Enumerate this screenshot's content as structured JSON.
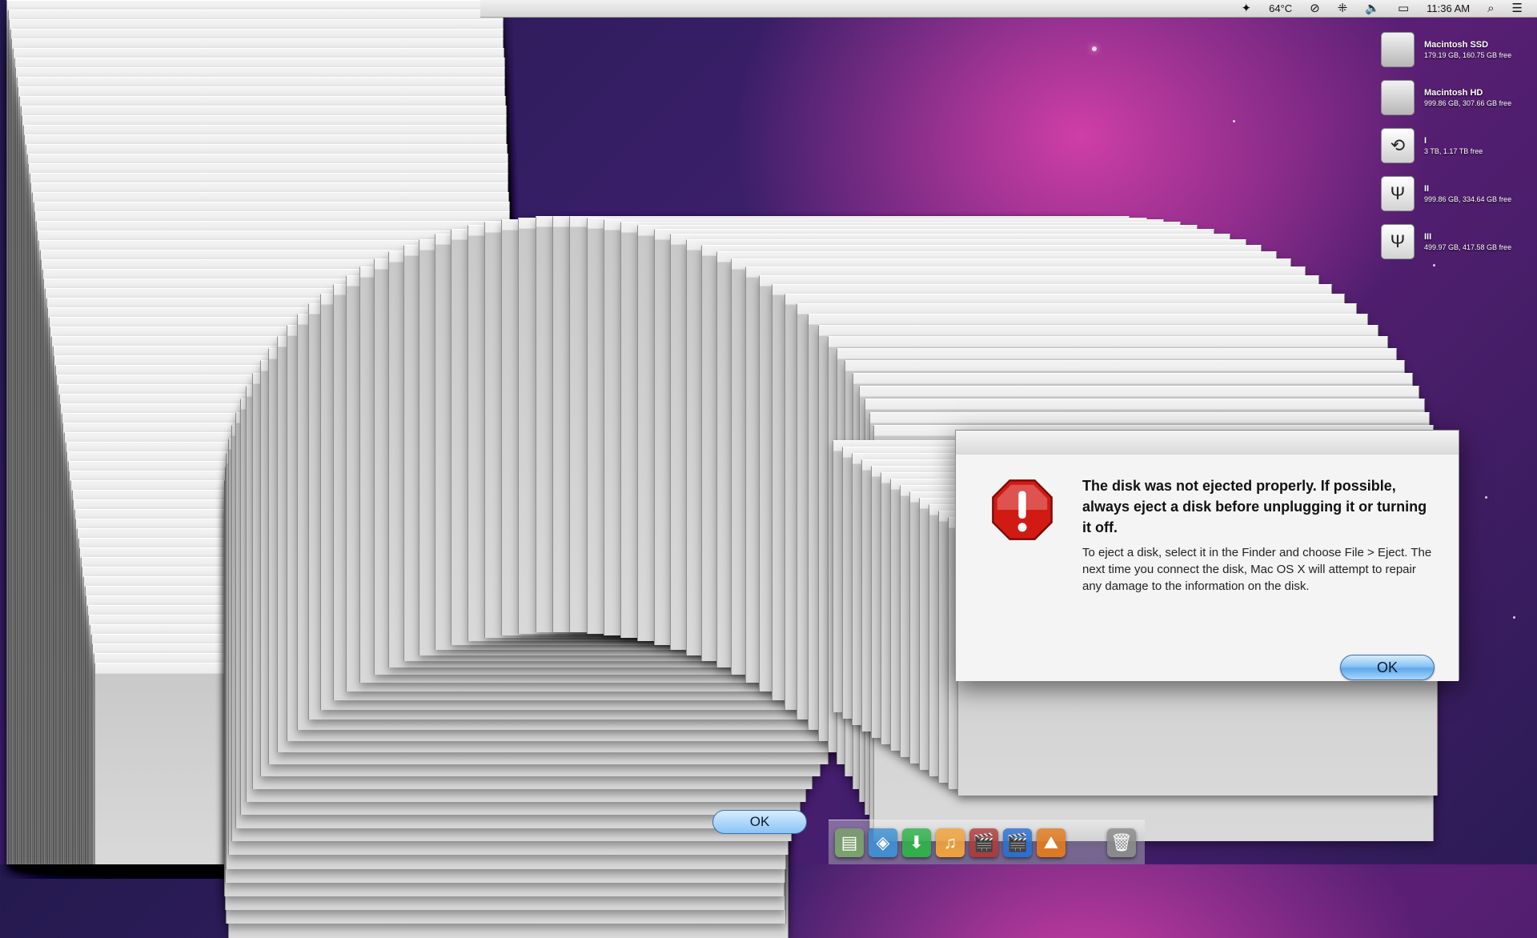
{
  "menubar": {
    "temperature": "64°C",
    "clock": "11:36 AM",
    "icons": [
      "dropbox-icon",
      "thermometer-reading",
      "sync-icon",
      "bluetooth-icon",
      "volume-icon",
      "battery-icon",
      "spotlight-icon",
      "notification-list-icon"
    ]
  },
  "desktop_disks": [
    {
      "name": "Macintosh SSD",
      "info": "179.19 GB, 160.75 GB free",
      "icon": "hard-drive-icon"
    },
    {
      "name": "Macintosh HD",
      "info": "999.86 GB, 307.66 GB free",
      "icon": "hard-drive-icon"
    },
    {
      "name": "I",
      "info": "3 TB, 1.17 TB free",
      "icon": "time-machine-icon"
    },
    {
      "name": "II",
      "info": "999.86 GB, 334.64 GB free",
      "icon": "usb-drive-icon"
    },
    {
      "name": "III",
      "info": "499.97 GB, 417.58 GB free",
      "icon": "usb-drive-icon"
    }
  ],
  "dialog": {
    "title": "The disk was not ejected properly. If possible, always eject a disk before unplugging it or turning it off.",
    "message": "To eject a disk, select it in the Finder and choose File > Eject. The next time you connect the disk, Mac OS X will attempt to repair any damage to the information on the disk.",
    "ok_label": "OK",
    "icon": "alert-stop-icon"
  },
  "dock": {
    "apps": [
      {
        "name": "finder-document",
        "color": "#7aa36a",
        "glyph": "▤"
      },
      {
        "name": "3d-box-app",
        "color": "#3f8fd2",
        "glyph": "◈"
      },
      {
        "name": "downloader-app",
        "color": "#2fb14a",
        "glyph": "⬇"
      },
      {
        "name": "itunes-app",
        "color": "#f0a23a",
        "glyph": "♫"
      },
      {
        "name": "video-editor-app",
        "color": "#b03a3a",
        "glyph": "🎬"
      },
      {
        "name": "imovie-app",
        "color": "#2a6fd1",
        "glyph": "🎬"
      },
      {
        "name": "photo-app",
        "color": "#e07a1f",
        "glyph": "⛰"
      },
      {
        "name": "trash",
        "color": "#8a8a8a",
        "glyph": "🗑"
      }
    ]
  },
  "ghost_ok_label": "OK"
}
